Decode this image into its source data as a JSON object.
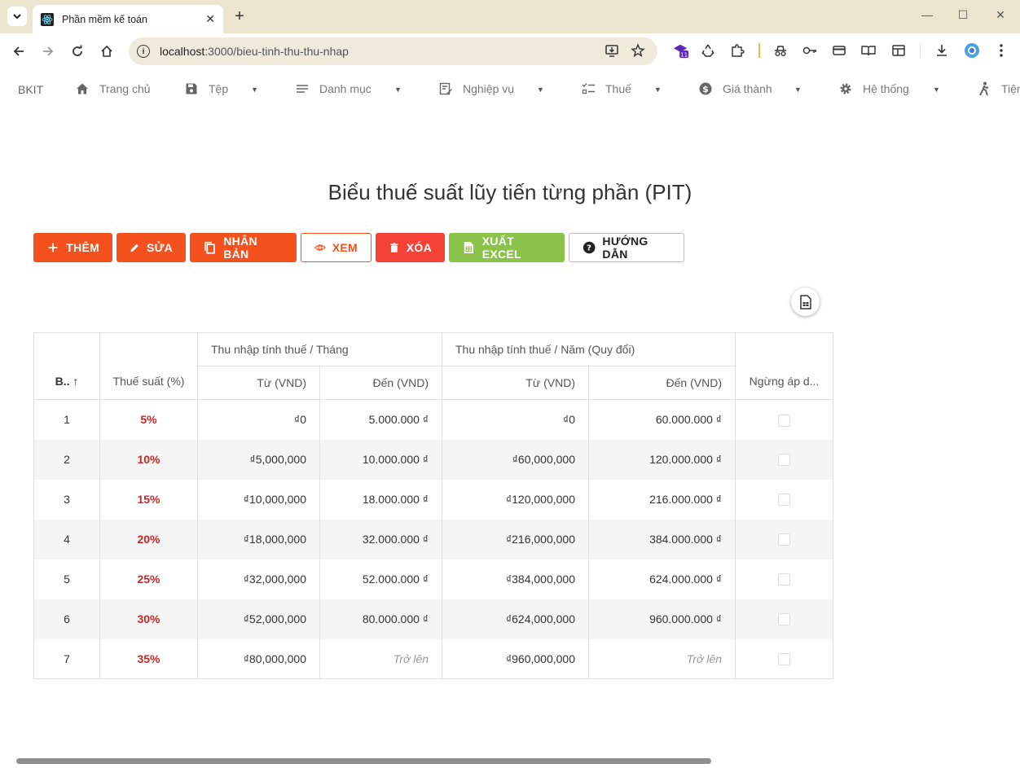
{
  "browser": {
    "tab_title": "Phần mềm kế toán",
    "url_host": "localhost",
    "url_rest": ":3000/bieu-tinh-thu-thu-nhap",
    "extension_badge": "11"
  },
  "nav": {
    "brand": "BKIT",
    "items": [
      {
        "label": "Trang chủ",
        "icon": "home-icon"
      },
      {
        "label": "Tệp",
        "icon": "save-icon"
      },
      {
        "label": "Danh mục",
        "icon": "list-icon"
      },
      {
        "label": "Nghiệp vụ",
        "icon": "edit-doc-icon"
      },
      {
        "label": "Thuế",
        "icon": "checklist-icon"
      },
      {
        "label": "Giá thành",
        "icon": "dollar-icon"
      },
      {
        "label": "Hệ thống",
        "icon": "gear-icon"
      },
      {
        "label": "Tiện",
        "icon": "walk-icon"
      }
    ]
  },
  "page": {
    "title": "Biểu thuế suất lũy tiến từng phần (PIT)"
  },
  "actions": {
    "add": "THÊM",
    "edit": "SỬA",
    "duplicate": "NHÂN BẢN",
    "view": "XEM",
    "delete": "XÓA",
    "export": "XUẤT EXCEL",
    "guide": "HƯỚNG DẪN"
  },
  "table": {
    "head": {
      "stt": "B..",
      "rate": "Thuế suất (%)",
      "month_group": "Thu nhập tính thuế / Tháng",
      "year_group": "Thu nhập tính thuế / Năm (Quy đổi)",
      "from": "Từ (VND)",
      "to": "Đến (VND)",
      "stop": "Ngừng áp d..."
    },
    "rows": [
      {
        "stt": "1",
        "rate": "5%",
        "m_from": "₫0",
        "m_to": "5.000.000 ₫",
        "y_from": "₫0",
        "y_to": "60.000.000 ₫"
      },
      {
        "stt": "2",
        "rate": "10%",
        "m_from": "₫5,000,000",
        "m_to": "10.000.000 ₫",
        "y_from": "₫60,000,000",
        "y_to": "120.000.000 ₫"
      },
      {
        "stt": "3",
        "rate": "15%",
        "m_from": "₫10,000,000",
        "m_to": "18.000.000 ₫",
        "y_from": "₫120,000,000",
        "y_to": "216.000.000 ₫"
      },
      {
        "stt": "4",
        "rate": "20%",
        "m_from": "₫18,000,000",
        "m_to": "32.000.000 ₫",
        "y_from": "₫216,000,000",
        "y_to": "384.000.000 ₫"
      },
      {
        "stt": "5",
        "rate": "25%",
        "m_from": "₫32,000,000",
        "m_to": "52.000.000 ₫",
        "y_from": "₫384,000,000",
        "y_to": "624.000.000 ₫"
      },
      {
        "stt": "6",
        "rate": "30%",
        "m_from": "₫52,000,000",
        "m_to": "80.000.000 ₫",
        "y_from": "₫624,000,000",
        "y_to": "960.000.000 ₫"
      },
      {
        "stt": "7",
        "rate": "35%",
        "m_from": "₫80,000,000",
        "m_to": "Trở lên",
        "y_from": "₫960,000,000",
        "y_to": "Trở lên"
      }
    ]
  },
  "colors": {
    "orange": "#f4511e",
    "red": "#f44336",
    "green": "#8bc34a",
    "rate_text": "#c62828"
  }
}
